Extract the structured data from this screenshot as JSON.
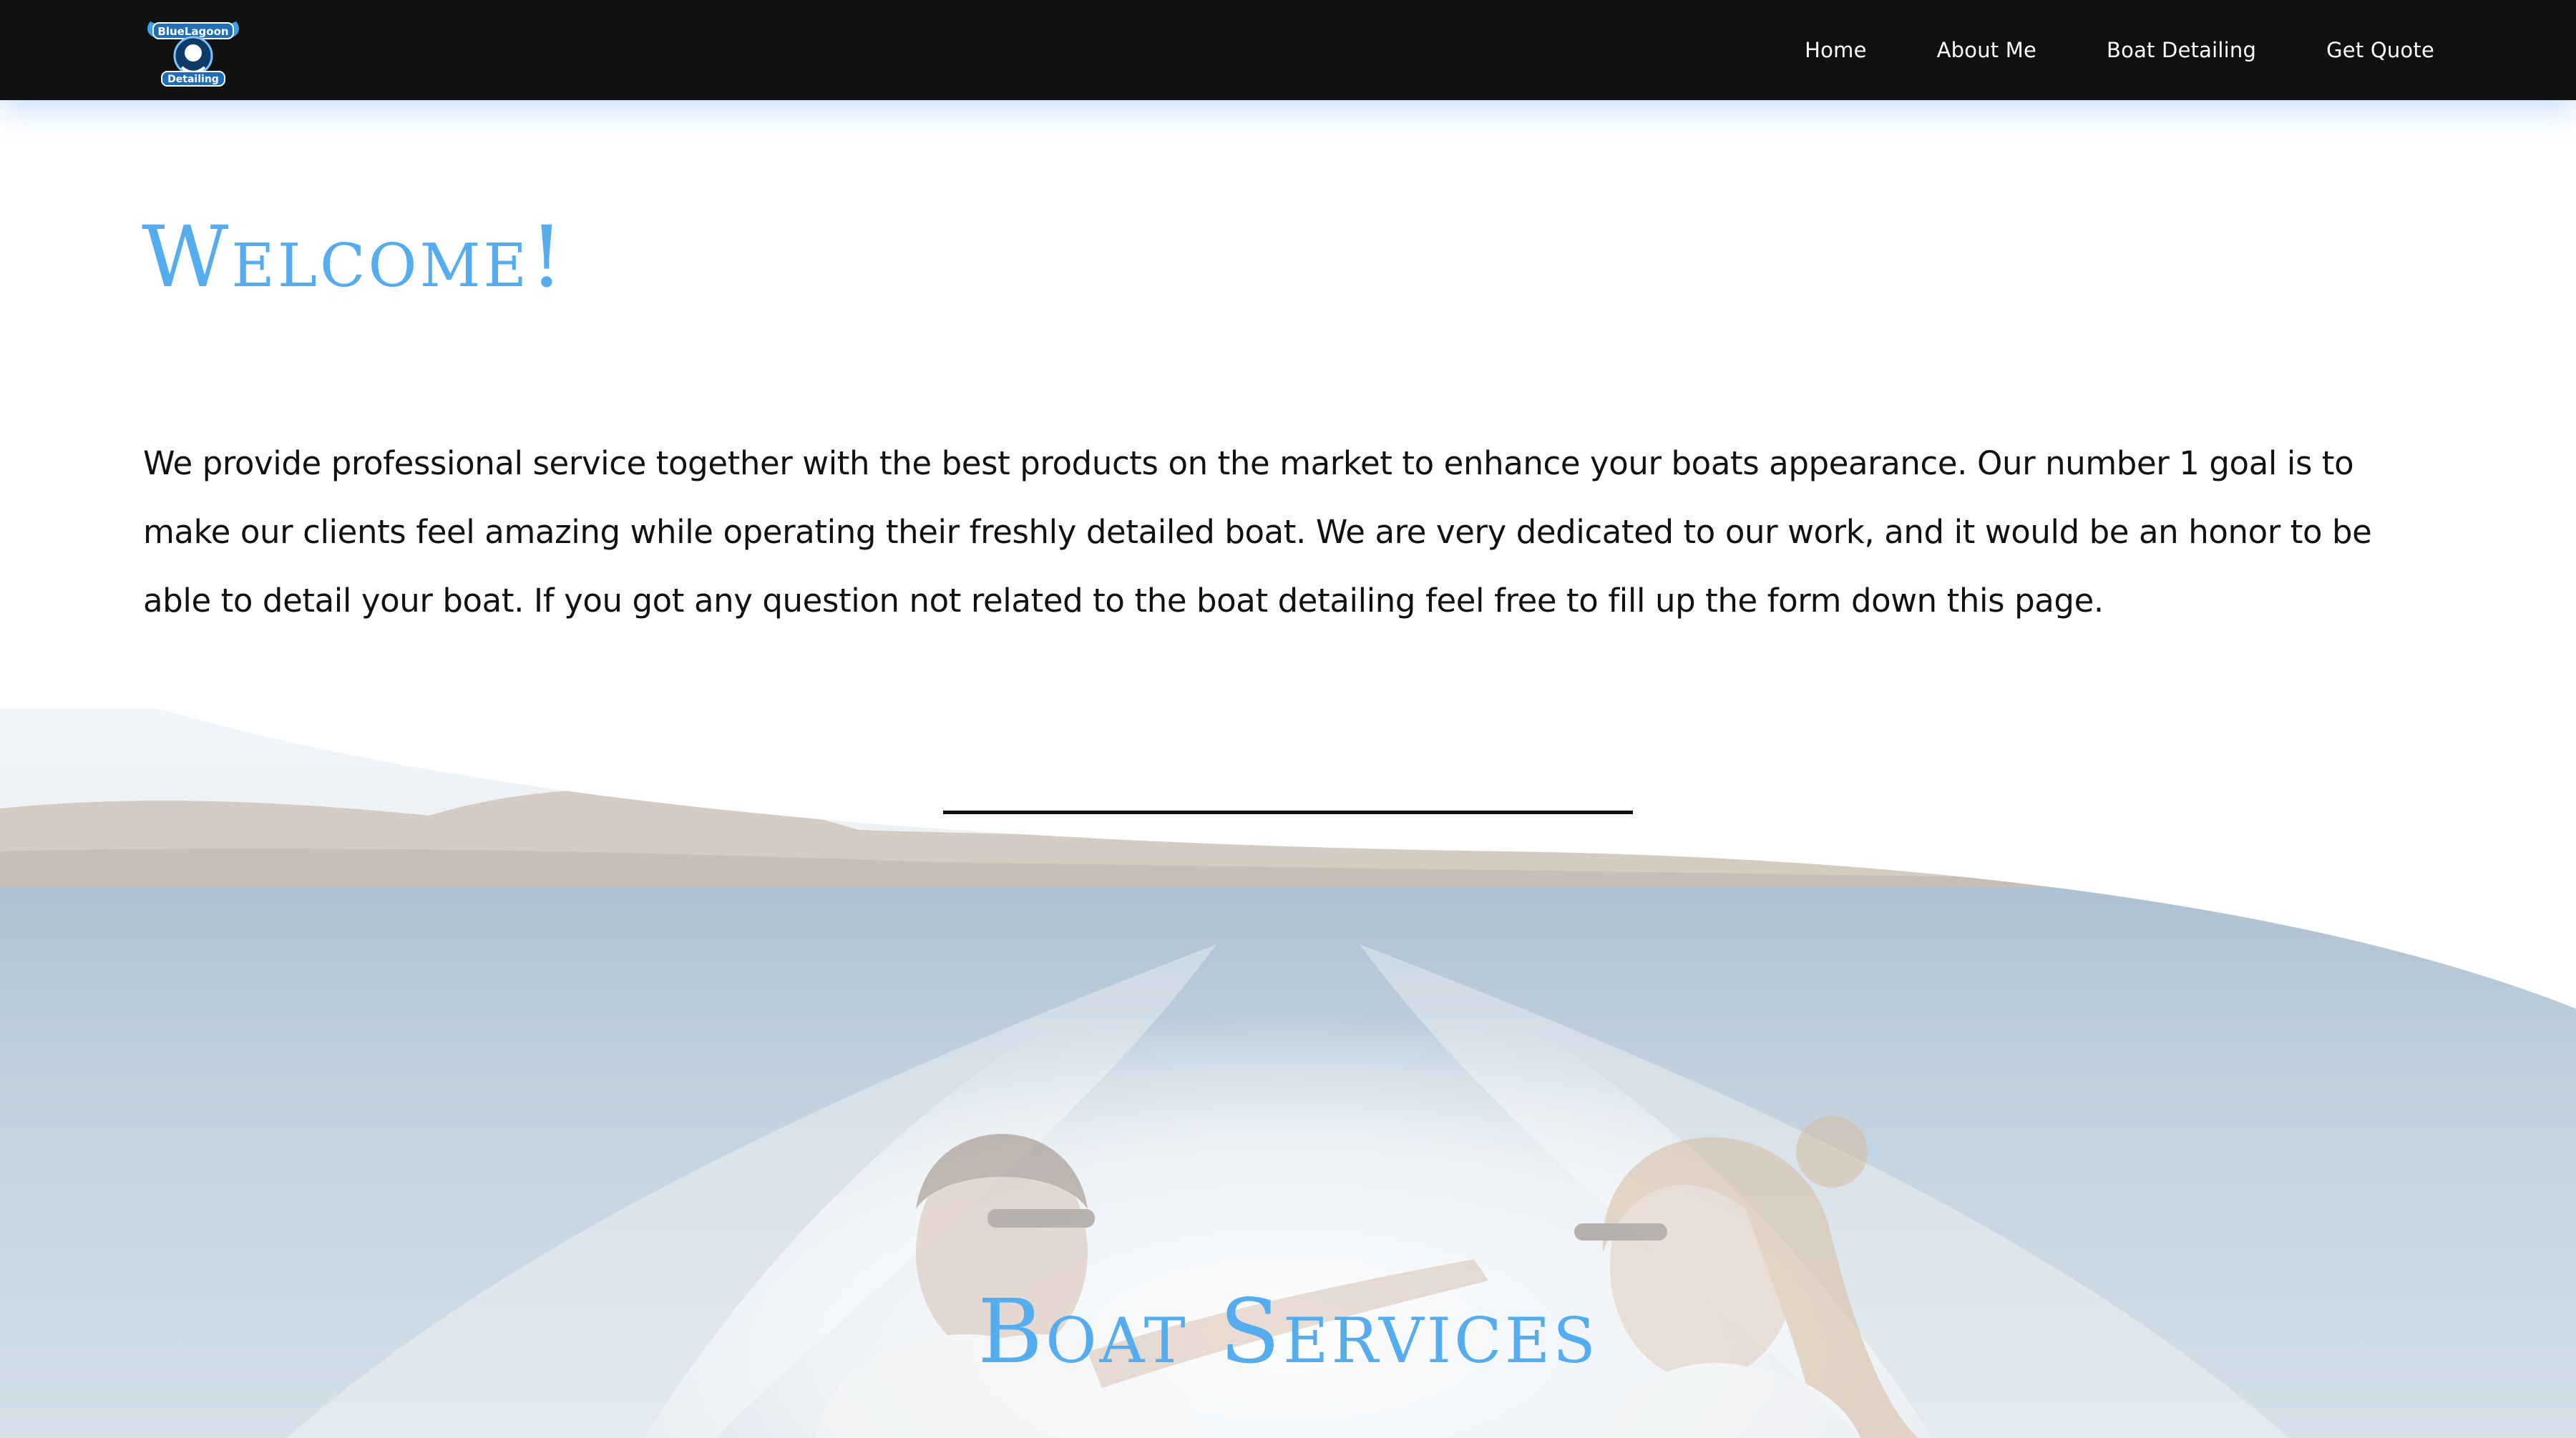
{
  "header": {
    "logo": {
      "name": "detailing-logo",
      "text_top": "BlueLagoon",
      "text_bottom": "Detailing"
    },
    "nav": [
      {
        "label": "Home"
      },
      {
        "label": "About Me"
      },
      {
        "label": "Boat Detailing"
      },
      {
        "label": "Get Quote"
      }
    ]
  },
  "welcome": {
    "title": "Welcome!",
    "body": "We provide professional service together with the best products on the market to enhance your boats appearance. Our number 1 goal is to make our clients feel amazing while operating their freshly detailed boat. We are very dedicated to our work, and it would be an honor to be able to detail your boat. If you got any question not related to the boat detailing feel free to fill up the form down this page."
  },
  "services": {
    "title": "Boat Services",
    "background_image": "couple-on-boat-photo"
  },
  "colors": {
    "header_bg": "#111111",
    "accent": "#55acee",
    "text": "#111111",
    "nav_text": "#ffffff"
  }
}
